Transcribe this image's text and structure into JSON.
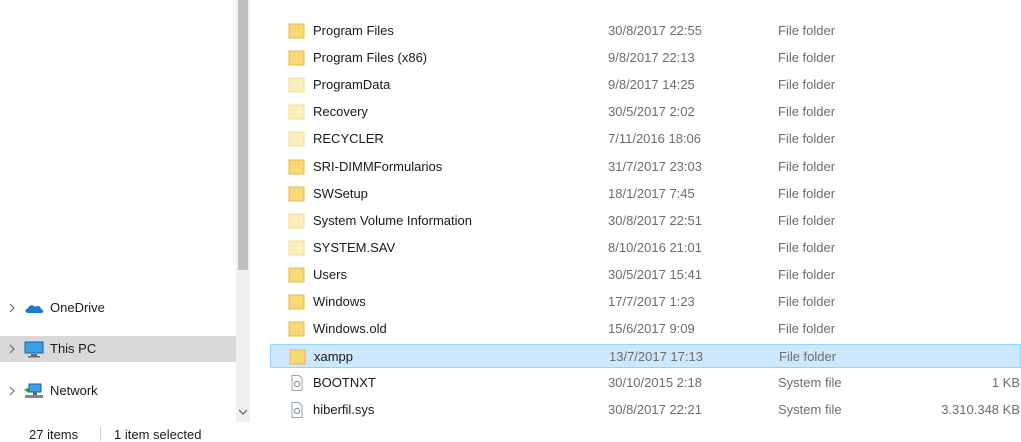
{
  "navigation": {
    "items": [
      {
        "label": "OneDrive",
        "icon": "cloud-icon",
        "selected": false
      },
      {
        "label": "This PC",
        "icon": "computer-icon",
        "selected": true
      },
      {
        "label": "Network",
        "icon": "network-icon",
        "selected": false
      }
    ]
  },
  "files": [
    {
      "name": "Program Files",
      "date": "30/8/2017 22:55",
      "type": "File folder",
      "size": "",
      "icon": "folder-icon"
    },
    {
      "name": "Program Files (x86)",
      "date": "9/8/2017 22:13",
      "type": "File folder",
      "size": "",
      "icon": "folder-icon"
    },
    {
      "name": "ProgramData",
      "date": "9/8/2017 14:25",
      "type": "File folder",
      "size": "",
      "icon": "hidden-folder-icon"
    },
    {
      "name": "Recovery",
      "date": "30/5/2017 2:02",
      "type": "File folder",
      "size": "",
      "icon": "hidden-folder-icon"
    },
    {
      "name": "RECYCLER",
      "date": "7/11/2016 18:06",
      "type": "File folder",
      "size": "",
      "icon": "hidden-folder-icon"
    },
    {
      "name": "SRI-DIMMFormularios",
      "date": "31/7/2017 23:03",
      "type": "File folder",
      "size": "",
      "icon": "folder-icon"
    },
    {
      "name": "SWSetup",
      "date": "18/1/2017 7:45",
      "type": "File folder",
      "size": "",
      "icon": "folder-icon"
    },
    {
      "name": "System Volume Information",
      "date": "30/8/2017 22:51",
      "type": "File folder",
      "size": "",
      "icon": "hidden-folder-icon"
    },
    {
      "name": "SYSTEM.SAV",
      "date": "8/10/2016 21:01",
      "type": "File folder",
      "size": "",
      "icon": "hidden-folder-icon"
    },
    {
      "name": "Users",
      "date": "30/5/2017 15:41",
      "type": "File folder",
      "size": "",
      "icon": "folder-icon"
    },
    {
      "name": "Windows",
      "date": "17/7/2017 1:23",
      "type": "File folder",
      "size": "",
      "icon": "folder-icon"
    },
    {
      "name": "Windows.old",
      "date": "15/6/2017 9:09",
      "type": "File folder",
      "size": "",
      "icon": "folder-icon"
    },
    {
      "name": "xampp",
      "date": "13/7/2017 17:13",
      "type": "File folder",
      "size": "",
      "icon": "folder-icon",
      "selected": true
    },
    {
      "name": "BOOTNXT",
      "date": "30/10/2015 2:18",
      "type": "System file",
      "size": "1 KB",
      "icon": "system-file-icon"
    },
    {
      "name": "hiberfil.sys",
      "date": "30/8/2017 22:21",
      "type": "System file",
      "size": "3.310.348 KB",
      "icon": "system-file-icon"
    }
  ],
  "status": {
    "count": "27 items",
    "selected": "1 item selected"
  },
  "colors": {
    "folder": "#f8d775",
    "hidden_folder": "#fbeeb8",
    "selection_bg": "#cce8ff",
    "selection_border": "#99d1ff",
    "nav_selected_bg": "#d9d9d9"
  }
}
